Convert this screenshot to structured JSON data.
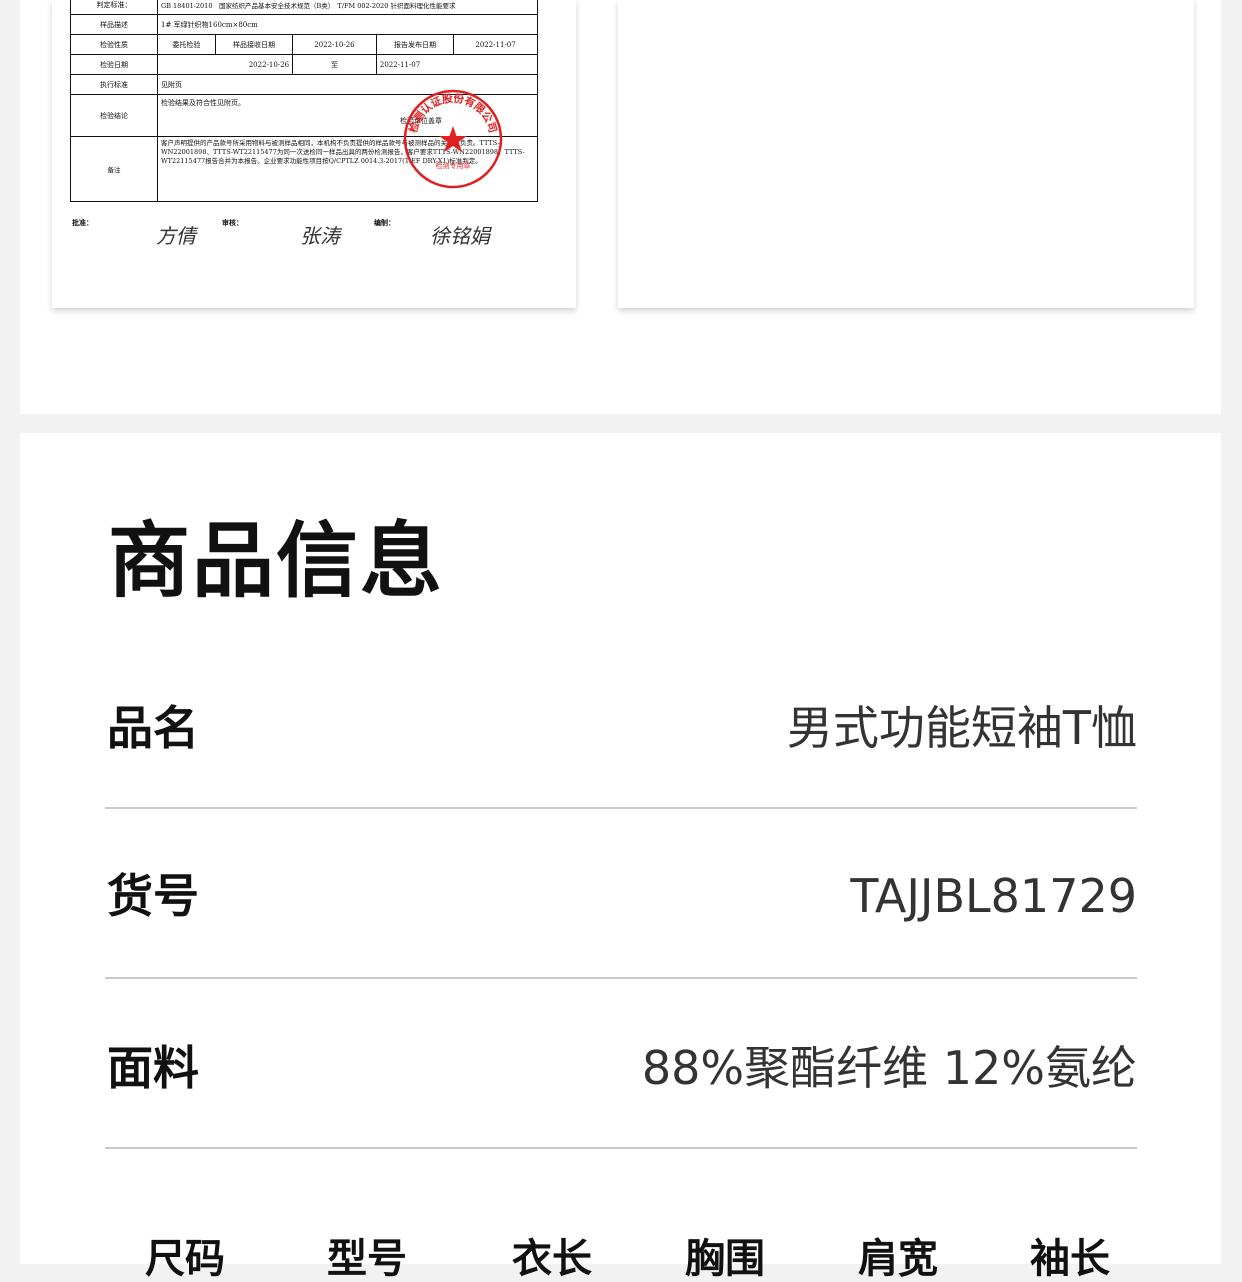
{
  "report": {
    "rows": [
      {
        "label": "判定标准：",
        "value": "GB 18401-2010　国家纺织产品基本安全技术规范（B类）　T/FM 002-2020 针织面料理化性能要求"
      },
      {
        "label": "样品描述",
        "value": "1# 军绿针织物160cm×80cm"
      },
      {
        "label": "检验性质",
        "value": "委托检验",
        "label2": "样品接收日期",
        "value2": "2022-10-26",
        "label3": "报告发布日期",
        "value3": "2022-11-07"
      },
      {
        "label": "检验日期",
        "value": "2022-10-26",
        "mid": "至",
        "value2": "2022-11-07"
      },
      {
        "label": "执行标准",
        "value": "见附页"
      },
      {
        "label": "检验结论",
        "value": "检验结果及符合性见附页。",
        "seal_text": "检验单位盖章"
      },
      {
        "label": "备注",
        "value": "客户声明提供的产品款号所采用物料与被测样品相同，本机构不负责提供的样品款号与被测样品的关联性负责。TTTS-WN22001898、TTTS-WT22115477为同一次送检同一样品出具的两份检测报告，客户要求TTTS-WN22001898、TTTS-WT22115477报告合并为本报告。企业要求功能性项目按Q/CPTLZ 0014.3-2017(TiEF DRY-X1)标准判定。"
      }
    ],
    "signatures": [
      {
        "label": "批准：",
        "name": "方倩"
      },
      {
        "label": "审核：",
        "name": "张涛"
      },
      {
        "label": "编制：",
        "name": "徐铭娟"
      }
    ],
    "stamp_text": "检测认证股份有限公司",
    "stamp_sub": "检测专用章"
  },
  "info": {
    "title": "商品信息",
    "rows": [
      {
        "key": "品名",
        "value": "男式功能短袖T恤"
      },
      {
        "key": "货号",
        "value": "TAJJBL81729"
      },
      {
        "key": "面料",
        "value": "88%聚酯纤维 12%氨纶"
      }
    ],
    "size_headers": [
      "尺码",
      "型号",
      "衣长",
      "胸围",
      "肩宽",
      "袖长"
    ]
  },
  "colors": {
    "background": "#f2f2f2",
    "panel": "#ffffff",
    "stamp_red": "#e02020",
    "divider": "#c9c9c9"
  }
}
